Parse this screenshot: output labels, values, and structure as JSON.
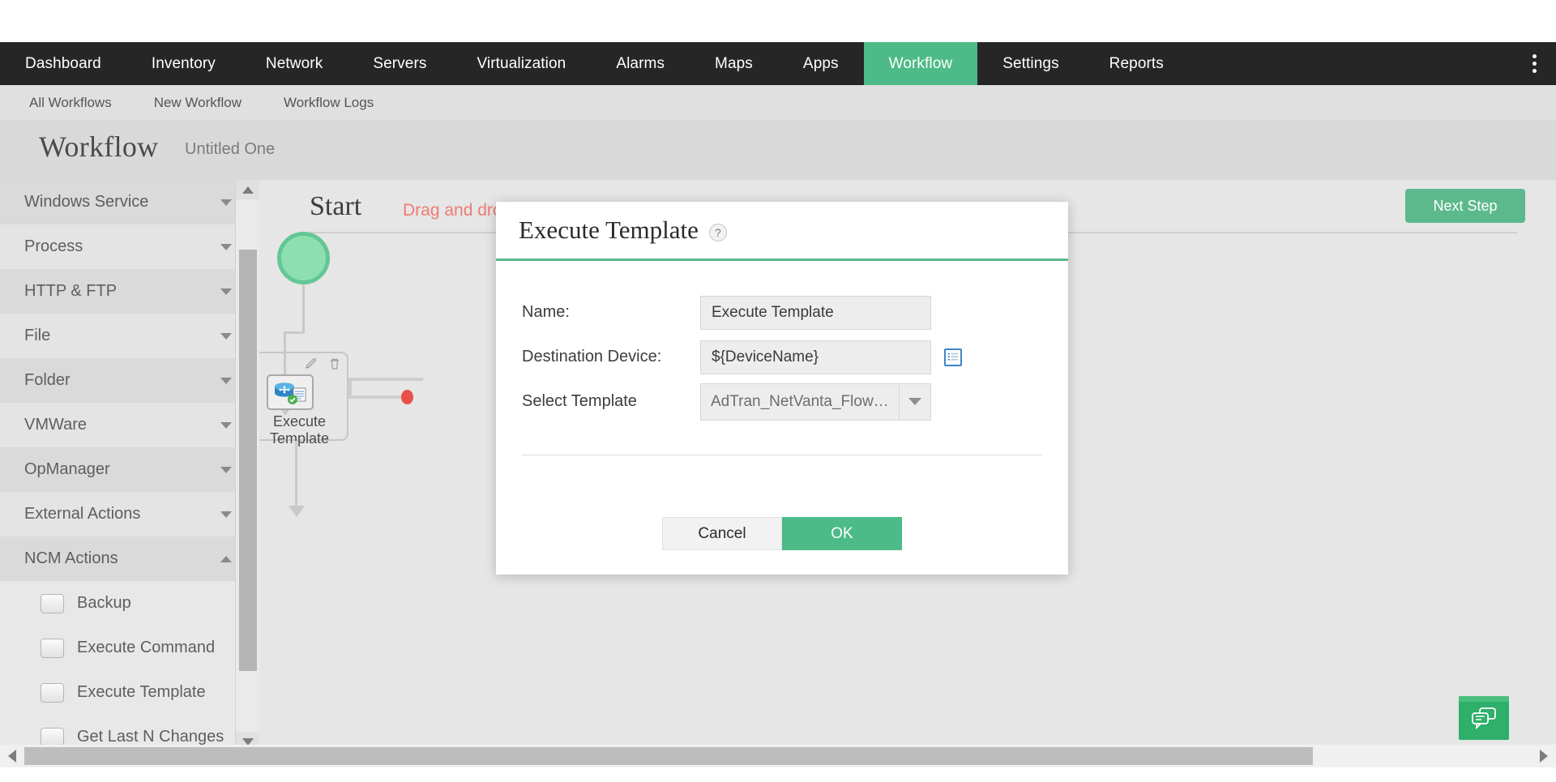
{
  "topnav": {
    "items": [
      {
        "label": "Dashboard",
        "active": false
      },
      {
        "label": "Inventory",
        "active": false
      },
      {
        "label": "Network",
        "active": false
      },
      {
        "label": "Servers",
        "active": false
      },
      {
        "label": "Virtualization",
        "active": false
      },
      {
        "label": "Alarms",
        "active": false
      },
      {
        "label": "Maps",
        "active": false
      },
      {
        "label": "Apps",
        "active": false
      },
      {
        "label": "Workflow",
        "active": true
      },
      {
        "label": "Settings",
        "active": false
      },
      {
        "label": "Reports",
        "active": false
      }
    ],
    "overflow_icon": "kebab-menu-icon",
    "active_color": "#4cbb87",
    "bar_color": "#262626"
  },
  "subnav": {
    "items": [
      {
        "label": "All Workflows"
      },
      {
        "label": "New Workflow"
      },
      {
        "label": "Workflow Logs"
      }
    ]
  },
  "page": {
    "title": "Workflow",
    "subtitle": "Untitled One"
  },
  "sidebar": {
    "groups": [
      {
        "label": "Windows Service",
        "expanded": false
      },
      {
        "label": "Process",
        "expanded": false
      },
      {
        "label": "HTTP & FTP",
        "expanded": false
      },
      {
        "label": "File",
        "expanded": false
      },
      {
        "label": "Folder",
        "expanded": false
      },
      {
        "label": "VMWare",
        "expanded": false
      },
      {
        "label": "OpManager",
        "expanded": false
      },
      {
        "label": "External Actions",
        "expanded": false
      },
      {
        "label": "NCM Actions",
        "expanded": true
      }
    ],
    "ncm_actions": [
      {
        "label": "Backup"
      },
      {
        "label": "Execute Command"
      },
      {
        "label": "Execute Template"
      },
      {
        "label": "Get Last N Changes"
      }
    ]
  },
  "canvas": {
    "start_label": "Start",
    "drag_hint": "Drag and drop workflow",
    "next_step_label": "Next Step",
    "start_node_name": "start-node",
    "node": {
      "label_line1": "Execute",
      "label_line2": "Template",
      "icon": "execute-template-node-icon",
      "edit_icon": "edit-pencil-icon",
      "delete_icon": "trash-icon"
    }
  },
  "modal": {
    "title": "Execute Template",
    "help_icon": "help-question-icon",
    "fields": {
      "name_label": "Name:",
      "name_value": "Execute Template",
      "destination_label": "Destination Device:",
      "destination_value": "${DeviceName}",
      "destination_picker_icon": "device-list-picker-icon",
      "template_label": "Select Template",
      "template_value": "AdTran_NetVanta_FlowExp...",
      "template_dropdown_icon": "chevron-down-icon"
    },
    "cancel_label": "Cancel",
    "ok_label": "OK",
    "accent_color": "#5cb98c"
  },
  "chat": {
    "icon": "chat-bubbles-icon",
    "color": "#2eaf6a"
  },
  "scrollbars": {
    "left_arrow_icon": "arrow-left-icon",
    "right_arrow_icon": "arrow-right-icon",
    "up_arrow_icon": "arrow-up-icon",
    "down_arrow_icon": "arrow-down-icon"
  }
}
